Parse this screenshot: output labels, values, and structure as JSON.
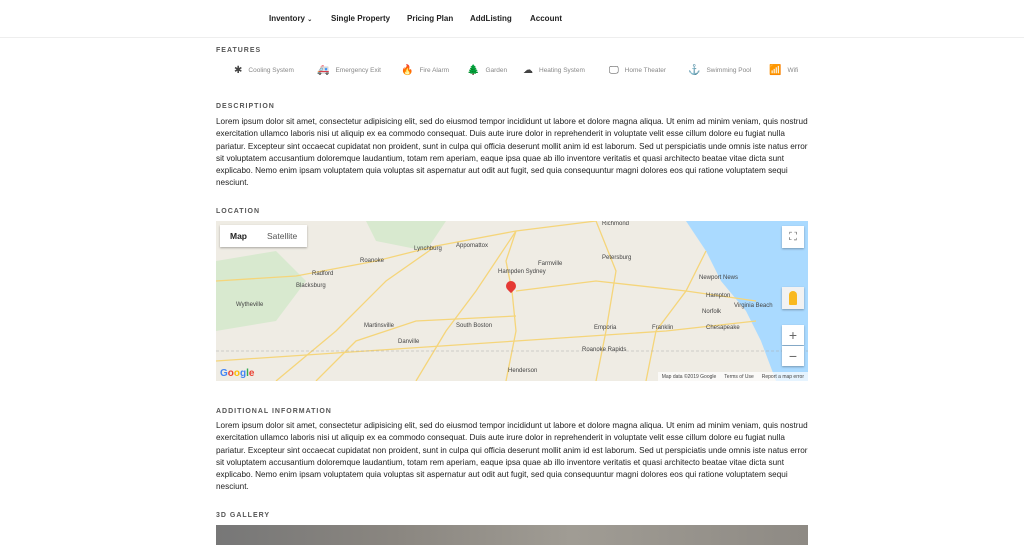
{
  "nav": {
    "items": [
      "Inventory",
      "Single Property",
      "Pricing Plan",
      "AddListing",
      "Account"
    ]
  },
  "features": {
    "title": "FEATURES",
    "items": [
      {
        "icon": "snowflake-icon",
        "glyph": "✱",
        "label": "Cooling System"
      },
      {
        "icon": "ambulance-icon",
        "glyph": "🚑",
        "label": "Emergency Exit"
      },
      {
        "icon": "fire-icon",
        "glyph": "🔥",
        "label": "Fire Alarm"
      },
      {
        "icon": "tree-icon",
        "glyph": "🌲",
        "label": "Garden"
      },
      {
        "icon": "cloud-icon",
        "glyph": "☁",
        "label": "Heating System"
      },
      {
        "icon": "tv-icon",
        "glyph": "🖵",
        "label": "Home Theater"
      },
      {
        "icon": "anchor-icon",
        "glyph": "⚓",
        "label": "Swimming Pool"
      },
      {
        "icon": "wifi-icon",
        "glyph": "📶",
        "label": "Wifi"
      }
    ]
  },
  "description": {
    "title": "DESCRIPTION",
    "text": "Lorem ipsum dolor sit amet, consectetur adipisicing elit, sed do eiusmod tempor incididunt ut labore et dolore magna aliqua. Ut enim ad minim veniam, quis nostrud exercitation ullamco laboris nisi ut aliquip ex ea commodo consequat. Duis aute irure dolor in reprehenderit in voluptate velit esse cillum dolore eu fugiat nulla pariatur. Excepteur sint occaecat cupidatat non proident, sunt in culpa qui officia deserunt mollit anim id est laborum. Sed ut perspiciatis unde omnis iste natus error sit voluptatem accusantium doloremque laudantium, totam rem aperiam, eaque ipsa quae ab illo inventore veritatis et quasi architecto beatae vitae dicta sunt explicabo. Nemo enim ipsam voluptatem quia voluptas sit aspernatur aut odit aut fugit, sed quia consequuntur magni dolores eos qui ratione voluptatem sequi nesciunt."
  },
  "location": {
    "title": "LOCATION",
    "map_tab": "Map",
    "satellite_tab": "Satellite",
    "attribution": "Map data ©2019 Google",
    "terms": "Terms of Use",
    "report": "Report a map error",
    "logo": "Google",
    "cities": [
      "Richmond",
      "Lynchburg",
      "Roanoke",
      "Blacksburg",
      "Radford",
      "Wytheville",
      "Martinsville",
      "Danville",
      "South Boston",
      "Hampden Sydney",
      "Farmville",
      "Petersburg",
      "Newport News",
      "Hampton",
      "Norfolk",
      "Virginia Beach",
      "Chesapeake",
      "Emporia",
      "Franklin",
      "Henderson",
      "Appomattox",
      "Roanoke Rapids"
    ]
  },
  "additional": {
    "title": "ADDITIONAL INFORMATION",
    "text": "Lorem ipsum dolor sit amet, consectetur adipisicing elit, sed do eiusmod tempor incididunt ut labore et dolore magna aliqua. Ut enim ad minim veniam, quis nostrud exercitation ullamco laboris nisi ut aliquip ex ea commodo consequat. Duis aute irure dolor in reprehenderit in voluptate velit esse cillum dolore eu fugiat nulla pariatur. Excepteur sint occaecat cupidatat non proident, sunt in culpa qui officia deserunt mollit anim id est laborum. Sed ut perspiciatis unde omnis iste natus error sit voluptatem accusantium doloremque laudantium, totam rem aperiam, eaque ipsa quae ab illo inventore veritatis et quasi architecto beatae vitae dicta sunt explicabo. Nemo enim ipsam voluptatem quia voluptas sit aspernatur aut odit aut fugit, sed quia consequuntur magni dolores eos qui ratione voluptatem sequi nesciunt."
  },
  "gallery": {
    "title": "3D GALLERY"
  }
}
